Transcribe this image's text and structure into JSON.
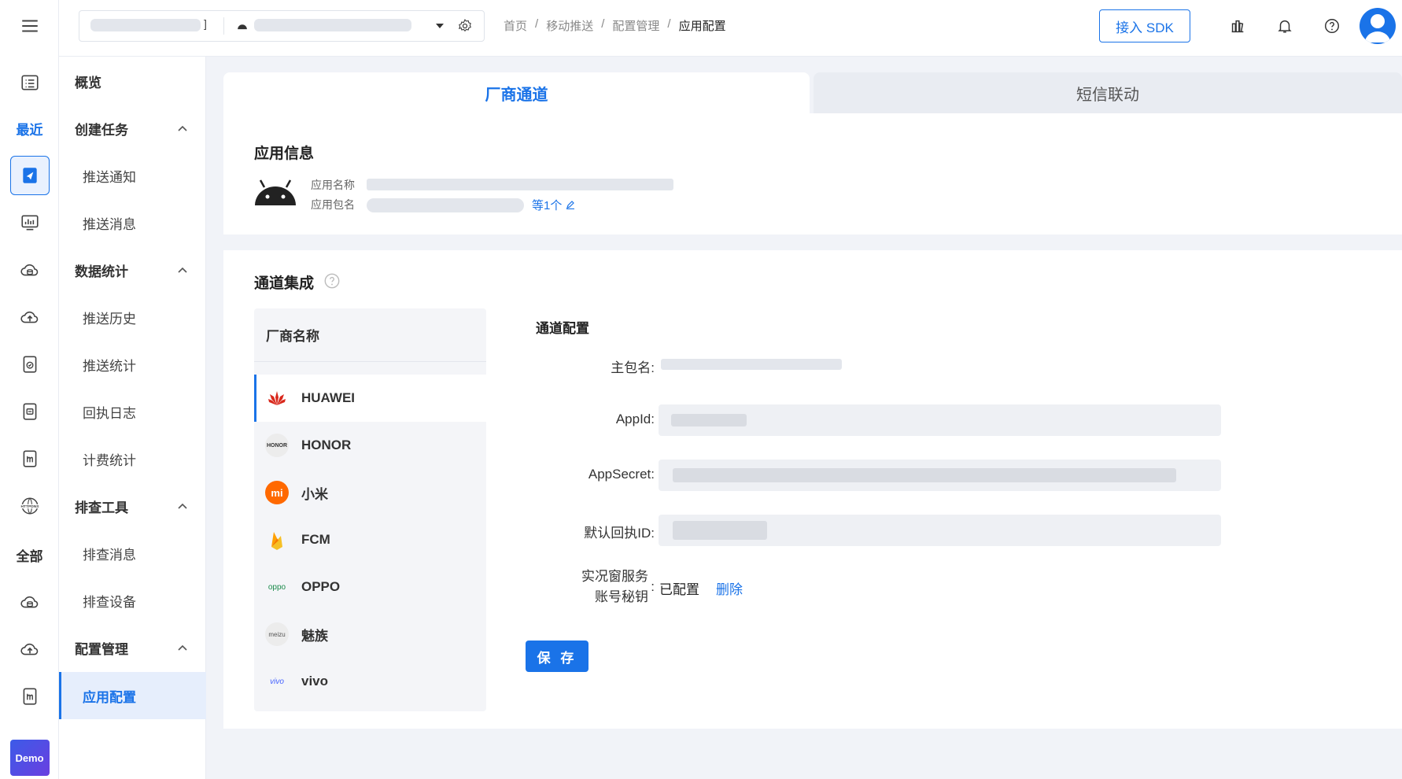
{
  "rail": {
    "recent_label": "最近",
    "all_label": "全部",
    "demo_label": "Demo"
  },
  "sidebar": {
    "overview": "概览",
    "groups": [
      {
        "label": "创建任务",
        "items": [
          "推送通知",
          "推送消息"
        ]
      },
      {
        "label": "数据统计",
        "items": [
          "推送历史",
          "推送统计",
          "回执日志",
          "计费统计"
        ]
      },
      {
        "label": "排查工具",
        "items": [
          "排查消息",
          "排查设备"
        ]
      },
      {
        "label": "配置管理",
        "items": [
          "应用配置"
        ]
      }
    ],
    "active_item": "应用配置"
  },
  "topbar": {
    "breadcrumb": [
      "首页",
      "移动推送",
      "配置管理",
      "应用配置"
    ],
    "separator": "/",
    "sdk_button": "接入 SDK"
  },
  "tabs": [
    "厂商通道",
    "短信联动"
  ],
  "app_info": {
    "title": "应用信息",
    "name_label": "应用名称",
    "package_label": "应用包名",
    "package_more": "等1个"
  },
  "channel": {
    "title": "通道集成",
    "vendor_header": "厂商名称",
    "vendors": [
      {
        "name": "HUAWEI",
        "logo": "huawei-logo",
        "color": "#d9281c"
      },
      {
        "name": "HONOR",
        "logo": "honor-logo",
        "color": "#333333"
      },
      {
        "name": "小米",
        "logo": "xiaomi-logo",
        "color": "#ff6900"
      },
      {
        "name": "FCM",
        "logo": "fcm-logo",
        "color": "#f6a623"
      },
      {
        "name": "OPPO",
        "logo": "oppo-logo",
        "color": "#1a8a4a"
      },
      {
        "name": "魅族",
        "logo": "meizu-logo",
        "color": "#555555"
      },
      {
        "name": "vivo",
        "logo": "vivo-logo",
        "color": "#415fff"
      }
    ],
    "active_vendor": "HUAWEI",
    "config_title": "通道配置",
    "fields": {
      "main_package": "主包名",
      "appid": "AppId",
      "appsecret": "AppSecret",
      "receipt_id": "默认回执ID",
      "live_window_line1": "实况窗服务",
      "live_window_line2": "账号秘钥",
      "colon": ":"
    },
    "live_window_status": "已配置",
    "delete_link": "删除",
    "save_button": "保 存"
  },
  "colors": {
    "accent": "#1a73e8"
  }
}
